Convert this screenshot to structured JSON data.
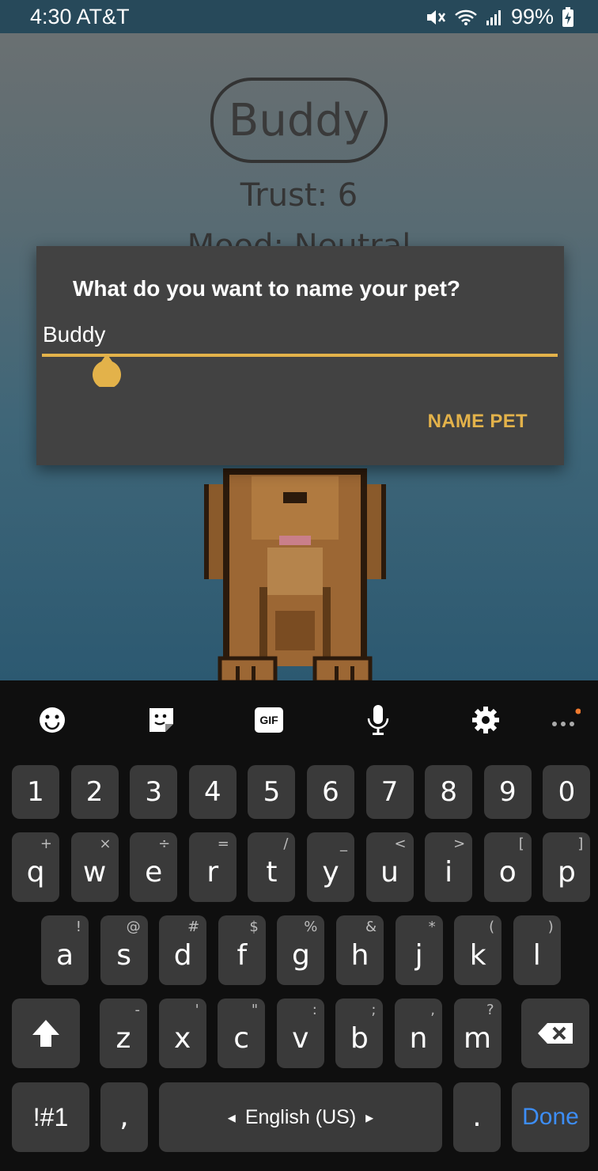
{
  "status_bar": {
    "time_carrier": "4:30 AT&T",
    "battery": "99%"
  },
  "pet": {
    "name": "Buddy",
    "trust": "Trust: 6",
    "mood": "Mood: Neutral"
  },
  "dialog": {
    "title": "What do you want to name your pet?",
    "input_value": "Buddy",
    "confirm_label": "NAME PET",
    "accent": "#e3b24a"
  },
  "keyboard": {
    "toolbar": [
      "emoji-icon",
      "sticker-icon",
      "gif-icon",
      "microphone-icon",
      "gear-icon",
      "more-icon"
    ],
    "gif_label": "GIF",
    "numbers": [
      "1",
      "2",
      "3",
      "4",
      "5",
      "6",
      "7",
      "8",
      "9",
      "0"
    ],
    "row1": [
      [
        "q",
        "+"
      ],
      [
        "w",
        "×"
      ],
      [
        "e",
        "÷"
      ],
      [
        "r",
        "="
      ],
      [
        "t",
        "/"
      ],
      [
        "y",
        "_"
      ],
      [
        "u",
        "<"
      ],
      [
        "i",
        ">"
      ],
      [
        "o",
        "["
      ],
      [
        "p",
        "]"
      ]
    ],
    "row2": [
      [
        "a",
        "!"
      ],
      [
        "s",
        "@"
      ],
      [
        "d",
        "#"
      ],
      [
        "f",
        "$"
      ],
      [
        "g",
        "%"
      ],
      [
        "h",
        "&"
      ],
      [
        "j",
        "*"
      ],
      [
        "k",
        "("
      ],
      [
        "l",
        ")"
      ]
    ],
    "row3": [
      [
        "z",
        "-"
      ],
      [
        "x",
        "'"
      ],
      [
        "c",
        "\""
      ],
      [
        "v",
        ":"
      ],
      [
        "b",
        ";"
      ],
      [
        "n",
        ","
      ],
      [
        "m",
        "?"
      ]
    ],
    "symbols_label": "!#1",
    "comma": ",",
    "space_label": "English (US)",
    "period": ".",
    "done_label": "Done"
  }
}
